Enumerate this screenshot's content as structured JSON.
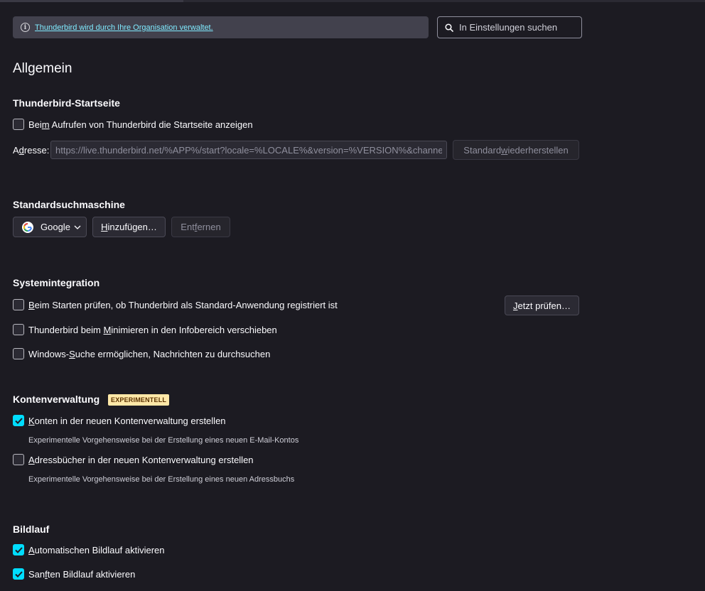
{
  "policy_banner": {
    "text": "Thunderbird wird durch Ihre Organisation verwaltet."
  },
  "search": {
    "placeholder": "In Einstellungen suchen"
  },
  "page_title": "Allgemein",
  "startpage": {
    "title": "Thunderbird-Startseite",
    "show_start": {
      "pre": "Bei",
      "accel": "m",
      "post": " Aufrufen von Thunderbird die Startseite anzeigen",
      "checked": false
    },
    "address_label": {
      "pre": "A",
      "accel": "d",
      "post": "resse:"
    },
    "address_value": "https://live.thunderbird.net/%APP%/start?locale=%LOCALE%&version=%VERSION%&channel",
    "restore_button": {
      "pre": "Standard ",
      "accel": "w",
      "post": "iederherstellen",
      "disabled": true
    }
  },
  "search_engine": {
    "title": "Standardsuchmaschine",
    "selected": "Google",
    "add_button": {
      "accel": "H",
      "post": "inzufügen…"
    },
    "remove_button": {
      "pre": "Ent",
      "accel": "f",
      "post": "ernen",
      "disabled": true
    }
  },
  "system": {
    "title": "Systemintegration",
    "check_default": {
      "accel": "B",
      "post": "eim Starten prüfen, ob Thunderbird als Standard-Anwendung registriert ist",
      "checked": false
    },
    "check_now_button": {
      "accel": "J",
      "post": "etzt prüfen…"
    },
    "minimize_tray": {
      "pre": "Thunderbird beim ",
      "accel": "M",
      "post": "inimieren in den Infobereich verschieben",
      "checked": false
    },
    "windows_search": {
      "pre": "Windows-",
      "accel": "S",
      "post": "uche ermöglichen, Nachrichten zu durchsuchen",
      "checked": false
    }
  },
  "accounts": {
    "title": "Kontenverwaltung",
    "badge": "EXPERIMENTELL",
    "new_accounts": {
      "accel": "K",
      "post": "onten in der neuen Kontenverwaltung erstellen",
      "checked": true
    },
    "new_accounts_desc": "Experimentelle Vorgehensweise bei der Erstellung eines neuen E-Mail-Kontos",
    "address_books": {
      "accel": "A",
      "post": "dressbücher in der neuen Kontenverwaltung erstellen",
      "checked": false
    },
    "address_books_desc": "Experimentelle Vorgehensweise bei der Erstellung eines neuen Adressbuchs"
  },
  "scrolling": {
    "title": "Bildlauf",
    "autoscroll": {
      "accel": "A",
      "post": "utomatischen Bildlauf aktivieren",
      "checked": true
    },
    "smooth": {
      "pre": "San",
      "accel": "f",
      "post": "ten Bildlauf aktivieren",
      "checked": true
    }
  },
  "colors": {
    "accent": "#00ddff",
    "background": "#1c1b22",
    "badge_bg": "#ffe8a8"
  },
  "icons": {
    "banner": "info-icon",
    "search": "search-icon",
    "engine": "google-logo-icon",
    "dropdown": "chevron-down-icon",
    "checked": "checkmark-icon"
  }
}
